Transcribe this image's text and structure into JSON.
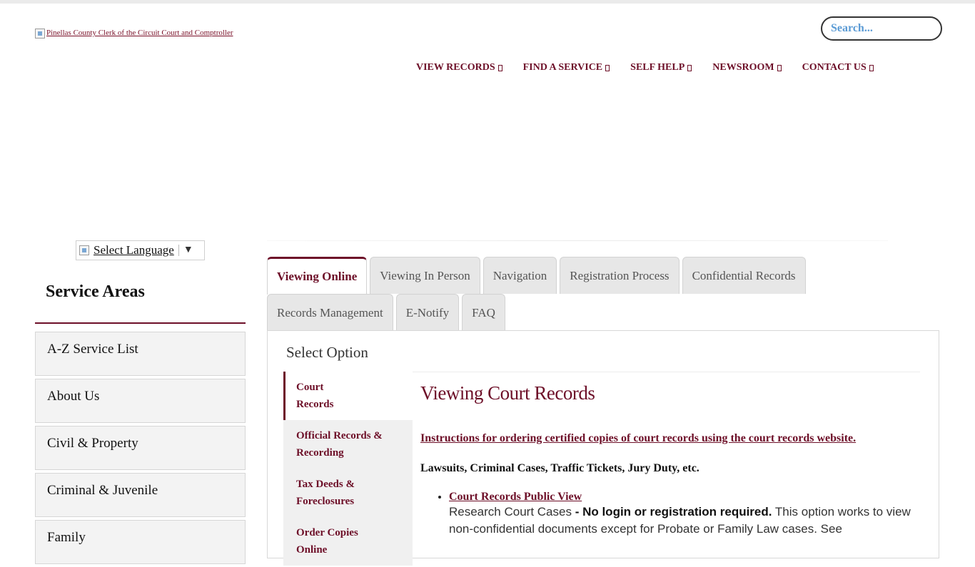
{
  "header": {
    "logo_alt": "Pinellas County Clerk of the Circuit Court and Comptroller",
    "search_placeholder": "Search..."
  },
  "nav": {
    "items": [
      "VIEW RECORDS",
      "FIND A SERVICE",
      "SELF HELP",
      "NEWSROOM",
      "CONTACT US"
    ]
  },
  "language": {
    "label": "Select Language"
  },
  "sidebar": {
    "title": "Service Areas",
    "items": [
      "A-Z Service List",
      "About Us",
      "Civil & Property",
      "Criminal & Juvenile",
      "Family"
    ]
  },
  "tabs": {
    "row1": [
      "Viewing Online",
      "Viewing In Person",
      "Navigation",
      "Registration Process",
      "Confidential Records"
    ],
    "row2": [
      "Records Management",
      "E-Notify",
      "FAQ"
    ],
    "active": "Viewing Online"
  },
  "panel": {
    "select_option": "Select Option",
    "vtabs": [
      "Court Records",
      "Official Records & Recording",
      "Tax Deeds & Foreclosures",
      "Order Copies Online"
    ],
    "active_vtab": "Court Records",
    "heading": "Viewing Court Records",
    "instructions_link": "Instructions for ordering certified copies of court records using the court records website.",
    "lawsuits_line": "Lawsuits, Criminal Cases, Traffic Tickets, Jury Duty, etc.",
    "bullet_link": "Court Records Public View",
    "bullet_desc_1": "Research Court Cases",
    "bullet_desc_bold": " - No login or registration required.",
    "bullet_desc_2": " This option works to view non-confidential documents except for Probate or Family Law cases.  See"
  },
  "colors": {
    "brand": "#6d0f28",
    "search_text": "#5b9bd5"
  }
}
